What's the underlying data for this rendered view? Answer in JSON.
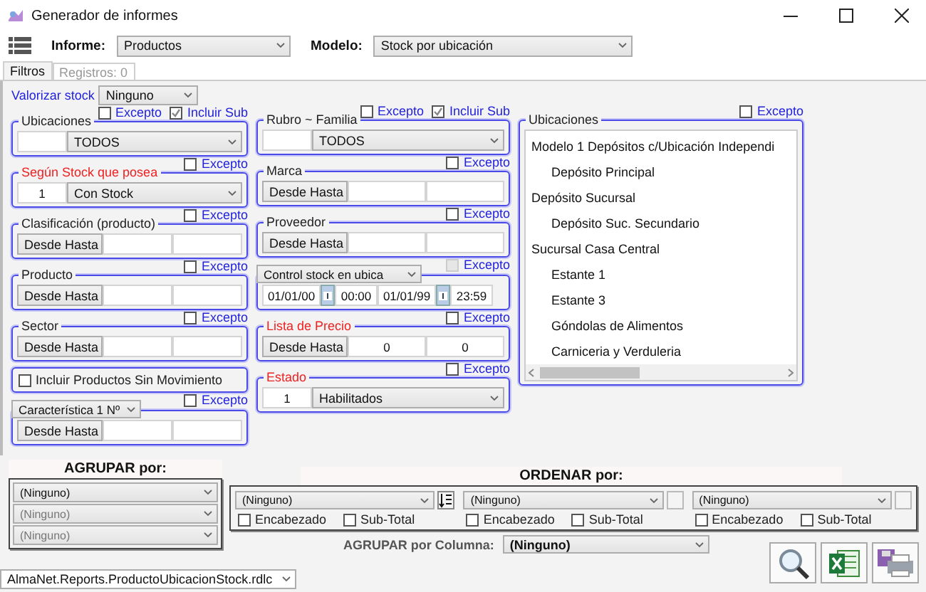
{
  "window": {
    "title": "Generador de informes"
  },
  "toolbar": {
    "report_label": "Informe:",
    "report": "Productos",
    "model_label": "Modelo:",
    "model": "Stock por ubicación"
  },
  "tabs": [
    {
      "label": "Filtros",
      "selected": true
    },
    {
      "label": "Registros: 0",
      "selected": false
    }
  ],
  "stock_valuation": {
    "label": "Valorizar stock",
    "value": "Ninguno"
  },
  "filters": {
    "left": [
      {
        "kind": "code",
        "title": "Ubicaciones",
        "required": false,
        "except": {
          "label": "Excepto",
          "checked": false,
          "disabled": false
        },
        "include_sub": {
          "label": "Incluir Sub",
          "checked": true
        },
        "value": "TODOS"
      },
      {
        "kind": "code",
        "title": "Según Stock que posea",
        "required": true,
        "except": {
          "label": "Excepto",
          "checked": false,
          "disabled": false
        },
        "code": "1",
        "value": "Con Stock"
      },
      {
        "kind": "range",
        "title": "Clasificación (producto)",
        "required": false,
        "except": {
          "label": "Excepto",
          "checked": false,
          "disabled": false
        },
        "mode": "Desde Hasta"
      },
      {
        "kind": "range",
        "title": "Producto",
        "required": false,
        "except": {
          "label": "Excepto",
          "checked": false,
          "disabled": false
        },
        "mode": "Desde Hasta"
      },
      {
        "kind": "range",
        "title": "Sector",
        "required": false,
        "except": {
          "label": "Excepto",
          "checked": false,
          "disabled": false
        },
        "mode": "Desde Hasta"
      },
      {
        "kind": "check",
        "label": "Incluir Productos Sin Movimiento",
        "checked": false
      },
      {
        "kind": "range",
        "title": "Característica 1 Nº",
        "title_select": true,
        "required": false,
        "except": {
          "label": "Excepto",
          "checked": false,
          "disabled": false
        },
        "mode": "Desde Hasta"
      }
    ],
    "middle": [
      {
        "kind": "code",
        "title": "Rubro ~ Familia",
        "required": false,
        "except": {
          "label": "Excepto",
          "checked": false,
          "disabled": false
        },
        "include_sub": {
          "label": "Incluir Sub",
          "checked": true
        },
        "value": "TODOS"
      },
      {
        "kind": "range",
        "title": "Marca",
        "required": false,
        "except": {
          "label": "Excepto",
          "checked": false,
          "disabled": false
        },
        "mode": "Desde Hasta"
      },
      {
        "kind": "range",
        "title": "Proveedor",
        "required": false,
        "except": {
          "label": "Excepto",
          "checked": false,
          "disabled": false
        },
        "mode": "Desde Hasta"
      },
      {
        "kind": "dates",
        "title": "Control stock en ubica",
        "title_select": true,
        "required": false,
        "except": {
          "label": "Excepto",
          "checked": false,
          "disabled": true
        },
        "from_date": "01/01/00",
        "from_time": "00:00",
        "to_date": "01/01/99",
        "to_time": "23:59"
      },
      {
        "kind": "range",
        "title": "Lista de Precio",
        "required": true,
        "except": {
          "label": "Excepto",
          "checked": false,
          "disabled": false
        },
        "mode": "Desde Hasta",
        "from": "0",
        "to": "0"
      },
      {
        "kind": "code",
        "title": "Estado",
        "required": true,
        "except": {
          "label": "Excepto",
          "checked": false,
          "disabled": false
        },
        "code": "1",
        "value": "Habilitados"
      }
    ]
  },
  "locations": {
    "title": "Ubicaciones",
    "except": {
      "label": "Excepto",
      "checked": false,
      "disabled": false
    },
    "tree": [
      {
        "label": "Modelo 1 Depósitos c/Ubicación Independi",
        "children": [
          {
            "label": "Depósito Principal"
          }
        ]
      },
      {
        "label": "Depósito Sucursal",
        "children": [
          {
            "label": "Depósito Suc. Secundario"
          }
        ]
      },
      {
        "label": "Sucursal Casa Central",
        "children": [
          {
            "label": "Estante 1"
          },
          {
            "label": "Estante 3"
          },
          {
            "label": "Góndolas de Alimentos"
          },
          {
            "label": "Carniceria y Verduleria"
          }
        ]
      }
    ]
  },
  "group_by": {
    "title": "AGRUPAR por:",
    "fields": [
      {
        "value": "(Ninguno)",
        "disabled": false
      },
      {
        "value": "(Ninguno)",
        "disabled": true
      },
      {
        "value": "(Ninguno)",
        "disabled": true
      }
    ]
  },
  "order_by": {
    "title": "ORDENAR  por:",
    "columns": [
      {
        "value": "(Ninguno)",
        "sort_button": true,
        "header": {
          "label": "Encabezado",
          "checked": false
        },
        "subtotal": {
          "label": "Sub-Total",
          "checked": false
        }
      },
      {
        "value": "(Ninguno)",
        "sort_button": false,
        "header": {
          "label": "Encabezado",
          "checked": false
        },
        "subtotal": {
          "label": "Sub-Total",
          "checked": false
        }
      },
      {
        "value": "(Ninguno)",
        "sort_button": false,
        "header": {
          "label": "Encabezado",
          "checked": false
        },
        "subtotal": {
          "label": "Sub-Total",
          "checked": false
        }
      }
    ]
  },
  "group_by_column": {
    "label": "AGRUPAR por Columna:",
    "value": "(Ninguno)"
  },
  "report_file": "AlmaNet.Reports.ProductoUbicacionStock.rdlc"
}
